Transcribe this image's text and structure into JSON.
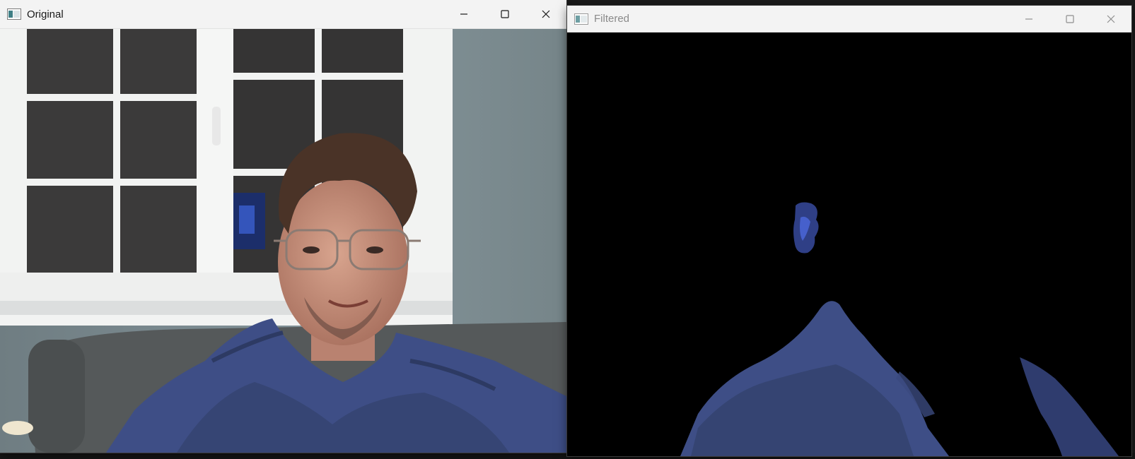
{
  "windows": {
    "original": {
      "title": "Original",
      "icon": "opencv-window-icon",
      "controls": [
        "minimize-icon",
        "maximize-icon",
        "close-icon"
      ]
    },
    "filtered": {
      "title": "Filtered",
      "icon": "opencv-window-icon",
      "controls": [
        "minimize-icon",
        "maximize-icon",
        "close-icon"
      ]
    }
  },
  "colors": {
    "titlebar": "#f3f3f3",
    "wall": "#7e8d92",
    "window_frame": "#f2f3f2",
    "night_glass": "#3b3a3a",
    "blanket_blue": "#3e4e86",
    "sofa": "#55595a",
    "filtered_background": "#000000"
  }
}
